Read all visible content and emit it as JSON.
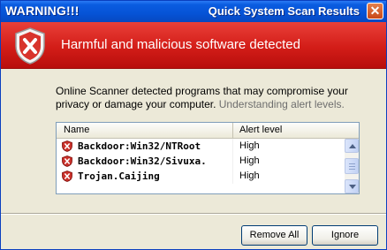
{
  "window": {
    "title_left": "WARNING!!!",
    "title_right": "Quick System Scan Results",
    "close_icon": "close-icon"
  },
  "banner": {
    "icon": "shield-x-icon",
    "text": "Harmful and malicious software detected",
    "color": "#d31d18"
  },
  "message": {
    "text": "Online Scanner detected programs that may compromise your privacy or damage your computer.",
    "link": "Understanding alert levels."
  },
  "table": {
    "columns": {
      "name": "Name",
      "level": "Alert level"
    },
    "rows": [
      {
        "name": "Backdoor:Win32/NTRoot",
        "level": "High",
        "icon": "shield-x-icon"
      },
      {
        "name": "Backdoor:Win32/Sivuxa.",
        "level": "High",
        "icon": "shield-x-icon"
      },
      {
        "name": "Trojan.Caijing",
        "level": "High",
        "icon": "shield-x-icon"
      }
    ]
  },
  "buttons": {
    "remove_all": "Remove All",
    "ignore": "Ignore"
  }
}
